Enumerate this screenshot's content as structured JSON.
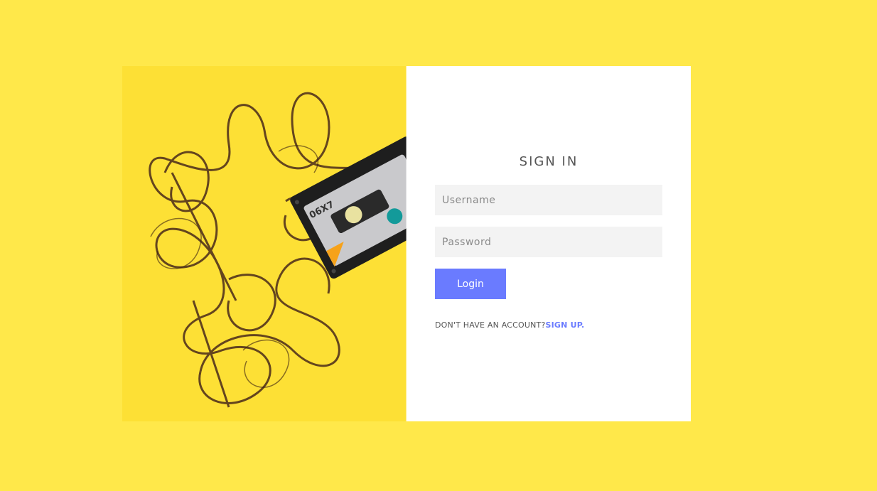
{
  "signin": {
    "title": "SIGN IN",
    "username_placeholder": "Username",
    "password_placeholder": "Password",
    "login_label": "Login",
    "no_account_text": "DON'T HAVE AN ACCOUNT?",
    "signup_label": "SIGN UP",
    "signup_suffix": "."
  },
  "photo": {
    "cassette_label": "06X7"
  },
  "colors": {
    "background": "#ffe84a",
    "accent": "#6a7bff",
    "input_bg": "#f3f3f3"
  }
}
